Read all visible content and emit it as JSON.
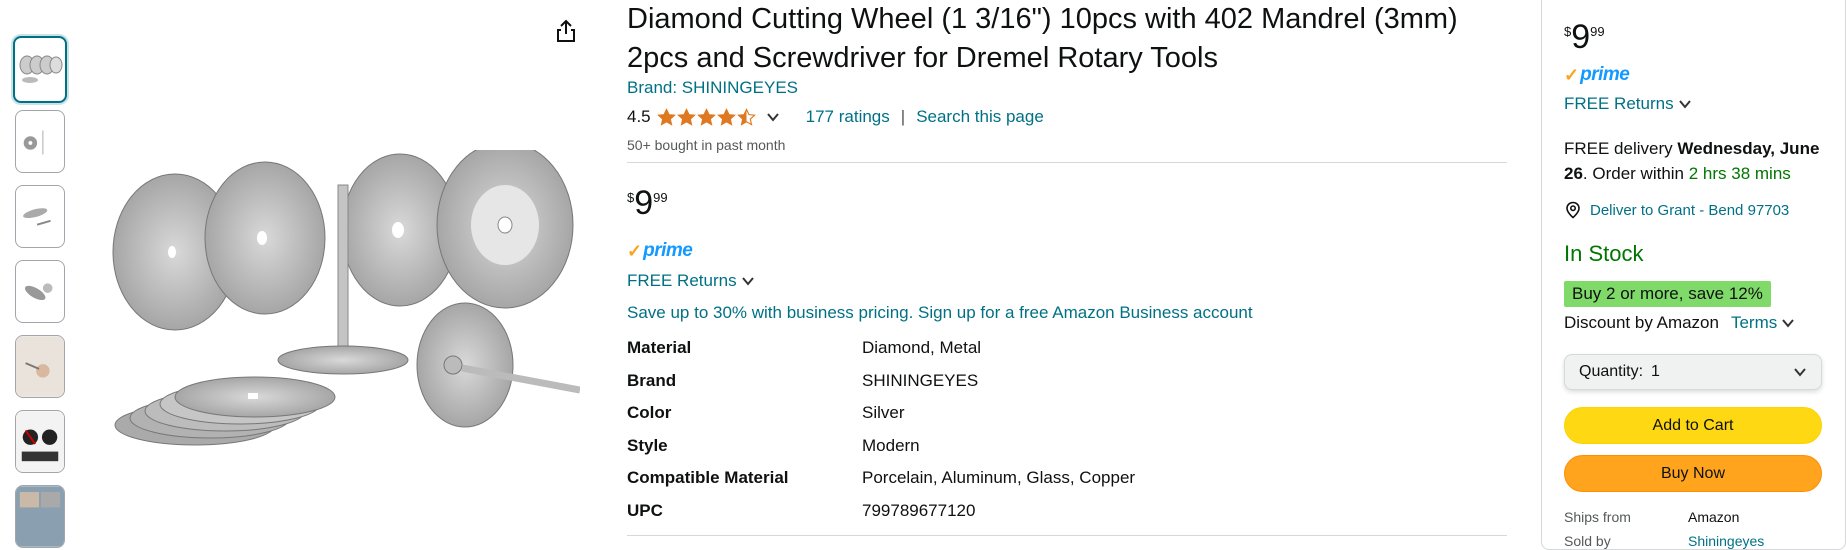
{
  "product": {
    "title": "Diamond Cutting Wheel (1 3/16\") 10pcs with 402 Mandrel (3mm) 2pcs and Screwdriver for Dremel Rotary Tools",
    "brand_link": "Brand: SHININGEYES",
    "rating_value": "4.5",
    "rating_stars": 4.5,
    "ratings_count": "177 ratings",
    "separator": "|",
    "search_page": "Search this page",
    "bought": "50+ bought in past month",
    "price": {
      "symbol": "$",
      "whole": "9",
      "fraction": "99"
    },
    "prime_label": "prime",
    "free_returns": "FREE Returns",
    "business": "Save up to 30% with business pricing. Sign up for a free Amazon Business account",
    "specs": [
      {
        "key": "Material",
        "value": "Diamond, Metal"
      },
      {
        "key": "Brand",
        "value": "SHININGEYES"
      },
      {
        "key": "Color",
        "value": "Silver"
      },
      {
        "key": "Style",
        "value": "Modern"
      },
      {
        "key": "Compatible Material",
        "value": "Porcelain, Aluminum, Glass, Copper"
      },
      {
        "key": "UPC",
        "value": "799789677120"
      }
    ]
  },
  "gallery": {
    "thumbnail_count": 7,
    "selected_index": 0,
    "share_icon": "share-icon"
  },
  "buybox": {
    "price": {
      "symbol": "$",
      "whole": "9",
      "fraction": "99"
    },
    "prime_label": "prime",
    "free_returns": "FREE Returns",
    "delivery_prefix": "FREE delivery ",
    "delivery_date": "Wednesday, June 26",
    "delivery_mid": ". Order within ",
    "delivery_countdown": "2 hrs 38 mins",
    "deliver_to": "Deliver to Grant - Bend 97703",
    "in_stock": "In Stock",
    "save_badge": "Buy 2 or more, save 12%",
    "discount": "Discount by Amazon",
    "terms": "Terms",
    "quantity_label": "Quantity:",
    "quantity_value": "1",
    "add_to_cart": "Add to Cart",
    "buy_now": "Buy Now",
    "ships_from_label": "Ships from",
    "ships_from_value": "Amazon",
    "sold_by_label": "Sold by",
    "sold_by_value": "Shiningeyes"
  },
  "colors": {
    "link": "#007185",
    "star": "#de7921",
    "prime": "#1399ff",
    "in_stock": "#007600",
    "save_badge": "#7fda69",
    "add_to_cart": "#ffd814",
    "buy_now": "#ffa41c"
  }
}
